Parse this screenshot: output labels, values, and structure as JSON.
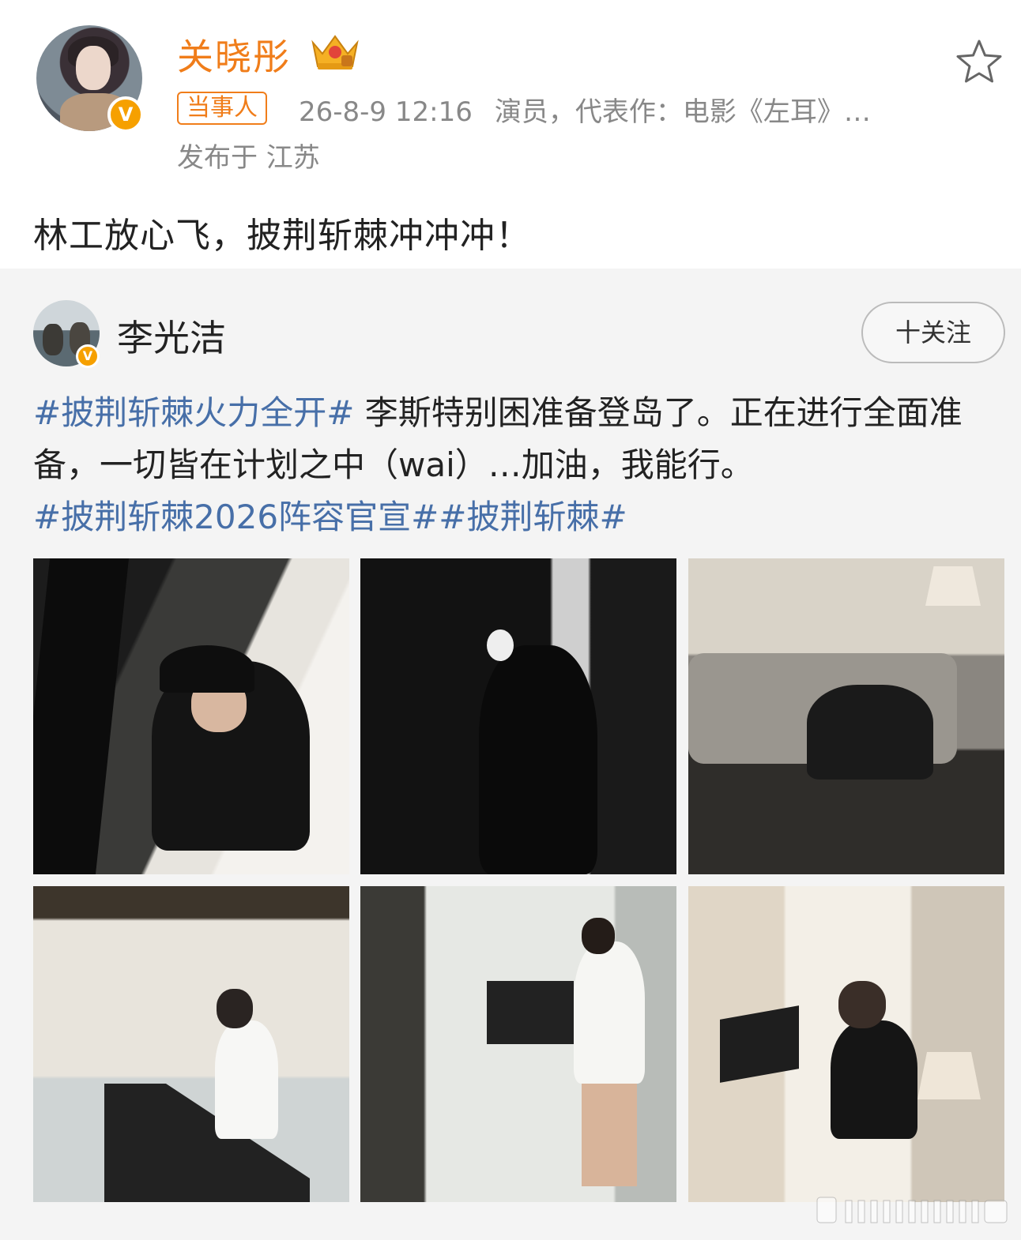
{
  "post": {
    "author": "关晓彤",
    "tag": "当事人",
    "datetime": "26-8-9 12:16",
    "bio": "演员，代表作：电影《左耳》…",
    "location": "发布于 江苏",
    "text": "林工放心飞，披荆斩棘冲冲冲！",
    "verified_mark": "V"
  },
  "repost": {
    "author": "李光洁",
    "follow_label": "十关注",
    "verified_mark": "V",
    "text_parts": {
      "tag1": "#披荆斩棘火力全开#",
      "body": " 李斯特别困准备登岛了。正在进行全面准备，一切皆在计划之中（wai）…加油，我能行。",
      "tag2": "#披荆斩棘2026阵容官宣#",
      "tag3": "#披荆斩棘#"
    },
    "photos_count": 6
  },
  "icons": {
    "favorite": "star-icon",
    "member": "crown-icon"
  },
  "colors": {
    "accent_orange": "#f07d1a",
    "hashtag_blue": "#476fa8",
    "verified_badge": "#f6a000"
  }
}
